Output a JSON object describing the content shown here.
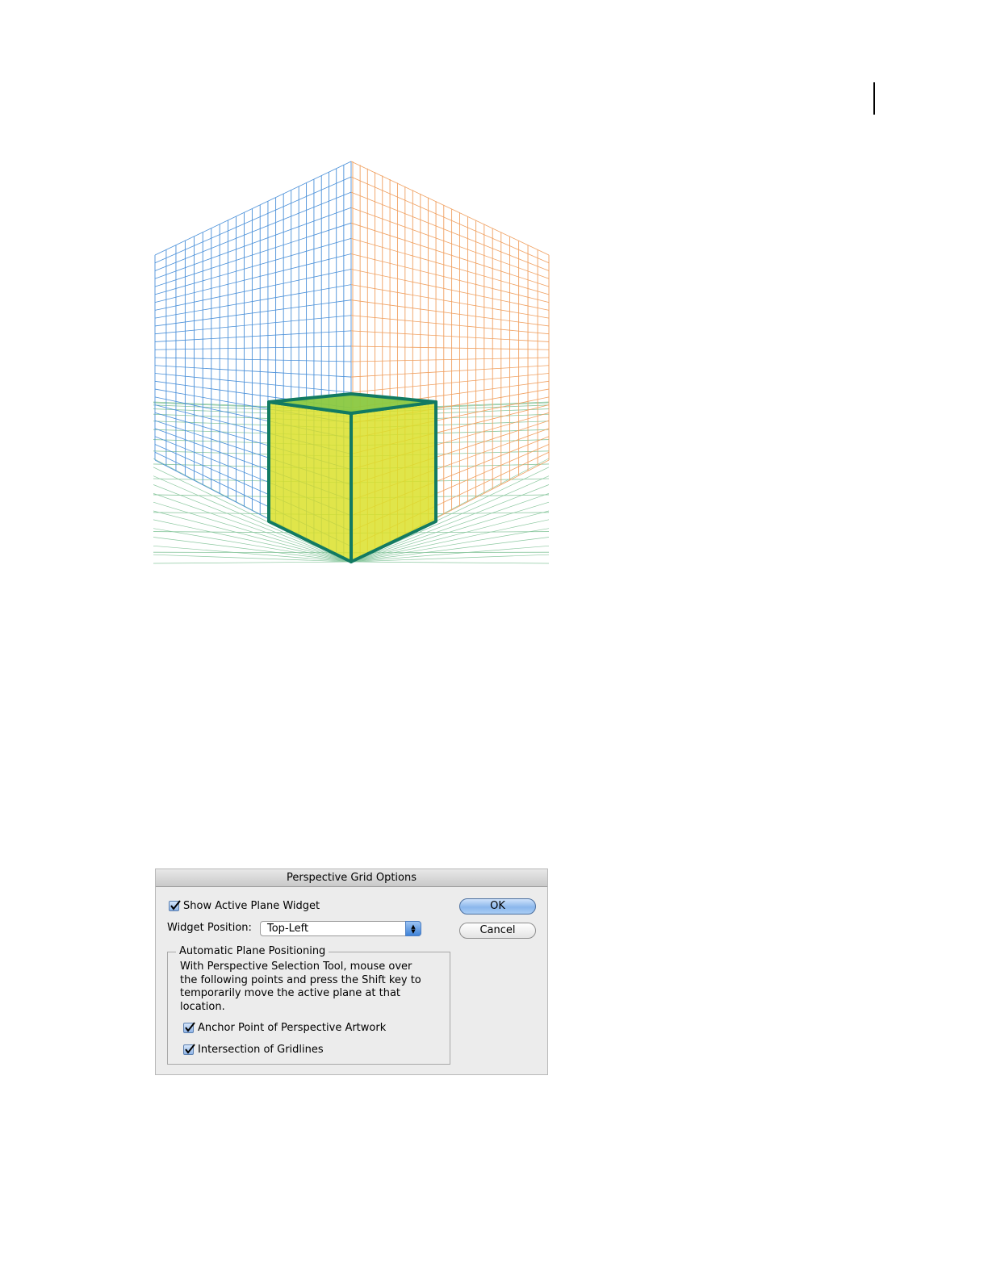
{
  "dialog": {
    "title": "Perspective Grid Options",
    "show_widget_label": "Show Active Plane Widget",
    "show_widget_checked": true,
    "widget_position_label": "Widget Position:",
    "widget_position_value": "Top-Left",
    "group_title": "Automatic Plane Positioning",
    "group_description": "With Perspective Selection Tool, mouse over the following points and press the Shift key to temporarily move the active plane at that location.",
    "anchor_point_label": "Anchor Point of Perspective Artwork",
    "anchor_point_checked": true,
    "intersection_label": "Intersection of Gridlines",
    "intersection_checked": true,
    "ok_label": "OK",
    "cancel_label": "Cancel"
  },
  "colors": {
    "left_plane": "#4a90d9",
    "right_plane": "#f0a060",
    "ground_plane": "#8cc8a0",
    "cube_outline": "#127a62",
    "cube_face": "#dbe02a",
    "cube_top": "#8ac840"
  }
}
